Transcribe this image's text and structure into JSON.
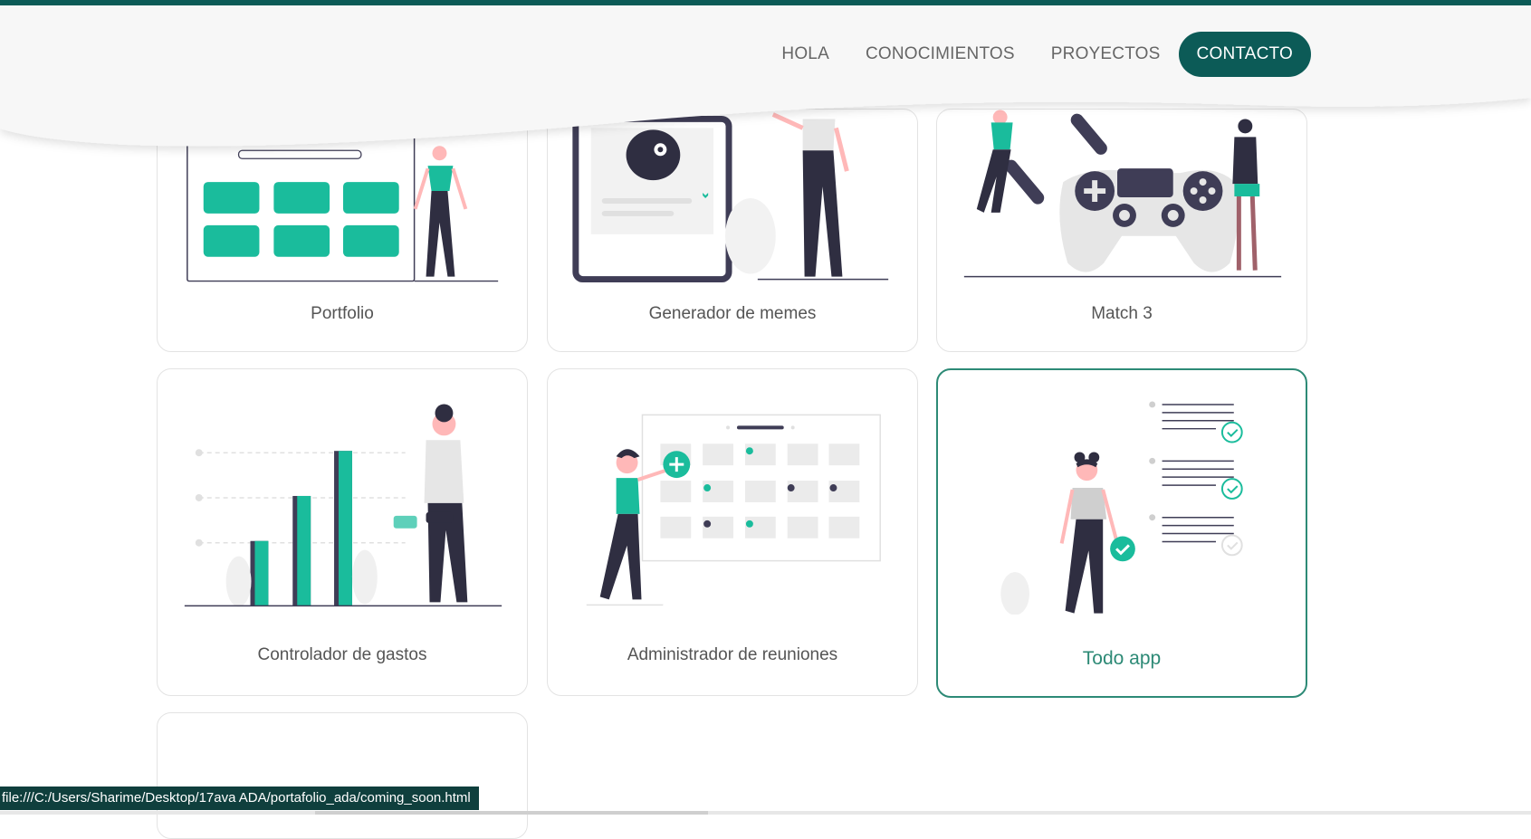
{
  "nav": {
    "items": [
      "HOLA",
      "CONOCIMIENTOS",
      "PROYECTOS"
    ],
    "contact_label": "CONTACTO"
  },
  "projects": [
    {
      "title": "Portfolio"
    },
    {
      "title": "Generador de memes"
    },
    {
      "title": "Match 3"
    },
    {
      "title": "Controlador de gastos"
    },
    {
      "title": "Administrador de reuniones"
    },
    {
      "title": "Todo app"
    }
  ],
  "status_bar": {
    "url": "file:///C:/Users/Sharime/Desktop/17ava ADA/portafolio_ada/coming_soon.html"
  },
  "colors": {
    "brand_dark": "#0c5b57",
    "accent": "#1abc9c",
    "active_border": "#2d8a76"
  }
}
